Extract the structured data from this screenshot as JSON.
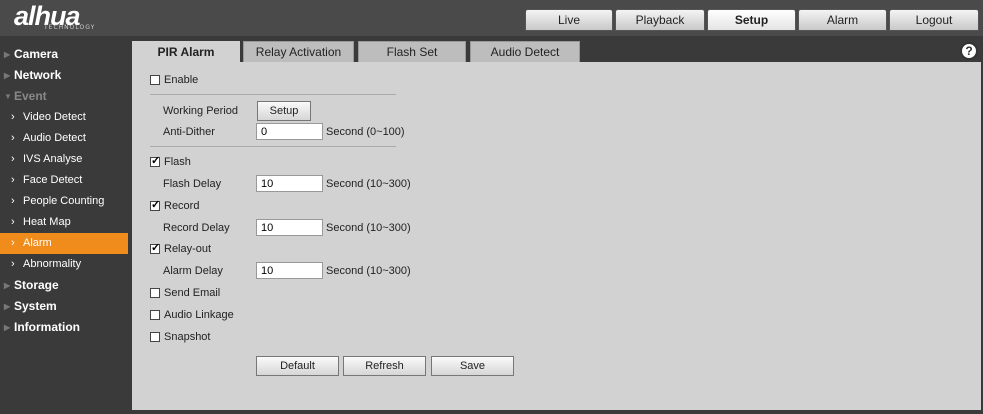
{
  "logo": {
    "text": "alhua",
    "subtext": "TECHNOLOGY"
  },
  "top_nav": [
    {
      "label": "Live"
    },
    {
      "label": "Playback"
    },
    {
      "label": "Setup",
      "active": true
    },
    {
      "label": "Alarm"
    },
    {
      "label": "Logout"
    }
  ],
  "sidebar": {
    "items": [
      {
        "label": "Camera"
      },
      {
        "label": "Network"
      },
      {
        "label": "Event"
      },
      {
        "label": "Video Detect"
      },
      {
        "label": "Audio Detect"
      },
      {
        "label": "IVS Analyse"
      },
      {
        "label": "Face Detect"
      },
      {
        "label": "People Counting"
      },
      {
        "label": "Heat Map"
      },
      {
        "label": "Alarm"
      },
      {
        "label": "Abnormality"
      },
      {
        "label": "Storage"
      },
      {
        "label": "System"
      },
      {
        "label": "Information"
      }
    ]
  },
  "tabs": [
    {
      "label": "PIR Alarm",
      "active": true
    },
    {
      "label": "Relay Activation"
    },
    {
      "label": "Flash Set"
    },
    {
      "label": "Audio Detect"
    }
  ],
  "help": {
    "icon": "help-icon",
    "glyph": "?"
  },
  "form": {
    "enable_label": "Enable",
    "enable_checked": false,
    "working_period_label": "Working Period",
    "setup_button": "Setup",
    "anti_dither_label": "Anti-Dither",
    "anti_dither_value": "0",
    "anti_dither_unit": "Second (0~100)",
    "flash_label": "Flash",
    "flash_checked": true,
    "flash_delay_label": "Flash Delay",
    "flash_delay_value": "10",
    "flash_delay_unit": "Second (10~300)",
    "record_label": "Record",
    "record_checked": true,
    "record_delay_label": "Record Delay",
    "record_delay_value": "10",
    "record_delay_unit": "Second (10~300)",
    "relay_out_label": "Relay-out",
    "relay_out_checked": true,
    "alarm_delay_label": "Alarm Delay",
    "alarm_delay_value": "10",
    "alarm_delay_unit": "Second (10~300)",
    "send_email_label": "Send Email",
    "send_email_checked": false,
    "audio_linkage_label": "Audio Linkage",
    "audio_linkage_checked": false,
    "snapshot_label": "Snapshot",
    "snapshot_checked": false
  },
  "actions": {
    "default_label": "Default",
    "refresh_label": "Refresh",
    "save_label": "Save"
  },
  "colors": {
    "accent": "#f08c1c",
    "panel": "#d2d2d2",
    "sidebar_bg": "#3a3a3a"
  }
}
